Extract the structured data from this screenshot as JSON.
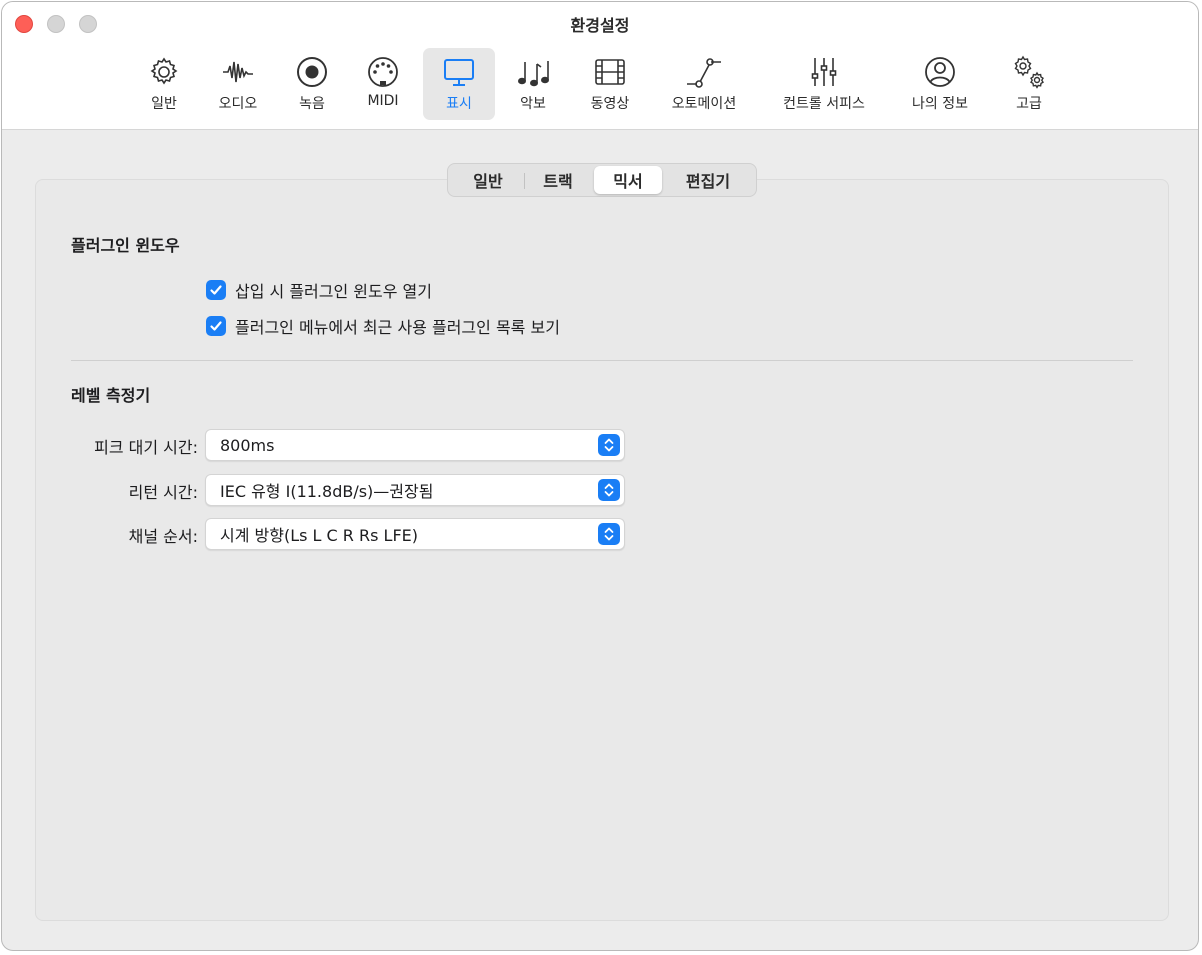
{
  "window": {
    "title": "환경설정"
  },
  "toolbar": {
    "items": [
      {
        "label": "일반",
        "icon": "gear-icon"
      },
      {
        "label": "오디오",
        "icon": "waveform-icon"
      },
      {
        "label": "녹음",
        "icon": "record-icon"
      },
      {
        "label": "MIDI",
        "icon": "midi-port-icon"
      },
      {
        "label": "표시",
        "icon": "display-icon",
        "selected": true
      },
      {
        "label": "악보",
        "icon": "music-notes-icon"
      },
      {
        "label": "동영상",
        "icon": "film-icon"
      },
      {
        "label": "오토메이션",
        "icon": "automation-curve-icon"
      },
      {
        "label": "컨트롤 서피스",
        "icon": "sliders-icon"
      },
      {
        "label": "나의 정보",
        "icon": "person-circle-icon"
      },
      {
        "label": "고급",
        "icon": "gears-icon"
      }
    ]
  },
  "tabs": [
    {
      "label": "일반"
    },
    {
      "label": "트랙"
    },
    {
      "label": "믹서",
      "active": true
    },
    {
      "label": "편집기"
    }
  ],
  "plugin_section": {
    "title": "플러그인 윈도우",
    "options": [
      {
        "label": "삽입 시 플러그인 윈도우 열기",
        "checked": true
      },
      {
        "label": "플러그인 메뉴에서 최근 사용 플러그인 목록 보기",
        "checked": true
      }
    ]
  },
  "meter_section": {
    "title": "레벨 측정기",
    "fields": [
      {
        "label": "피크 대기 시간:",
        "value": "800ms"
      },
      {
        "label": "리턴 시간:",
        "value": "IEC 유형 I(11.8dB/s)—권장됨"
      },
      {
        "label": "채널 순서:",
        "value": "시계 방향(Ls L C R Rs LFE)"
      }
    ]
  },
  "colors": {
    "accent": "#1a7ef5",
    "close": "#fe5f57"
  }
}
